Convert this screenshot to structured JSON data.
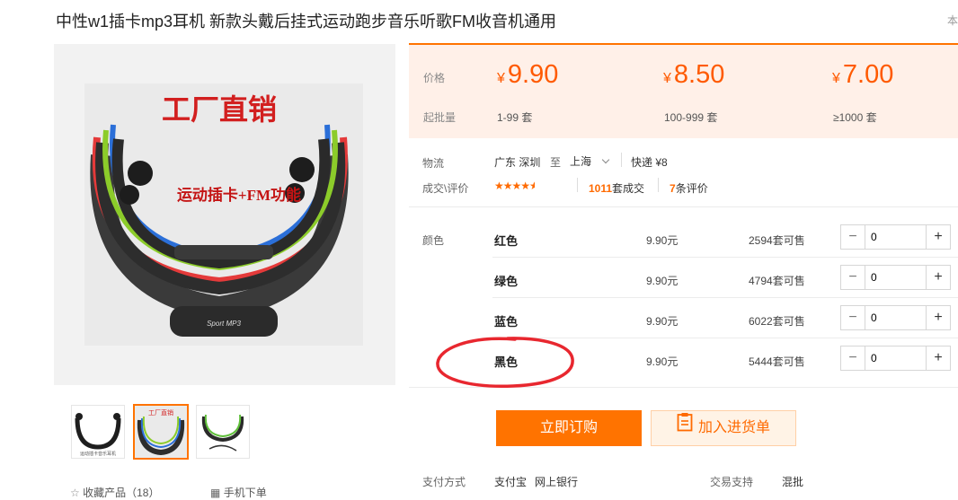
{
  "product": {
    "title": "中性w1插卡mp3耳机 新款头戴后挂式运动跑步音乐听歌FM收音机通用",
    "corner_text": "本",
    "image_banner": "工厂直销",
    "image_subtext": "运动插卡+FM功能",
    "image_device_label": "Sport MP3",
    "thumb1_caption": "运动插卡音乐耳机",
    "thumb2_caption": "工厂直销"
  },
  "pricing": {
    "price_label": "价格",
    "moq_label": "起批量",
    "currency": "¥",
    "tiers": [
      {
        "price": "9.90",
        "range": "1-99 套"
      },
      {
        "price": "8.50",
        "range": "100-999 套"
      },
      {
        "price": "7.00",
        "range": "≥1000 套"
      }
    ]
  },
  "logistics": {
    "label": "物流",
    "origin": "广东 深圳",
    "to": "至",
    "destination": "上海",
    "express": "快递 ¥8"
  },
  "deals": {
    "label": "成交\\评价",
    "rating": 4.5,
    "sold_count": "1011",
    "sold_suffix": "套成交",
    "review_count": "7",
    "review_suffix": "条评价"
  },
  "variants": {
    "label": "颜色",
    "rows": [
      {
        "color": "红色",
        "price": "9.90元",
        "stock": "2594套可售",
        "qty": "0"
      },
      {
        "color": "绿色",
        "price": "9.90元",
        "stock": "4794套可售",
        "qty": "0"
      },
      {
        "color": "蓝色",
        "price": "9.90元",
        "stock": "6022套可售",
        "qty": "0"
      },
      {
        "color": "黑色",
        "price": "9.90元",
        "stock": "5444套可售",
        "qty": "0"
      }
    ]
  },
  "actions": {
    "buy_now": "立即订购",
    "add_to_cart": "加入进货单"
  },
  "footer": {
    "payment_label": "支付方式",
    "payment_alipay": "支付宝",
    "payment_bank": "网上银行",
    "trade_label": "交易支持",
    "trade_value": "混批",
    "favorite_label": "收藏产品（18）",
    "mobile_label": "手机下单"
  },
  "colors": {
    "accent": "#ff7300",
    "price": "#ff5a00",
    "annotation": "#e8272f"
  }
}
